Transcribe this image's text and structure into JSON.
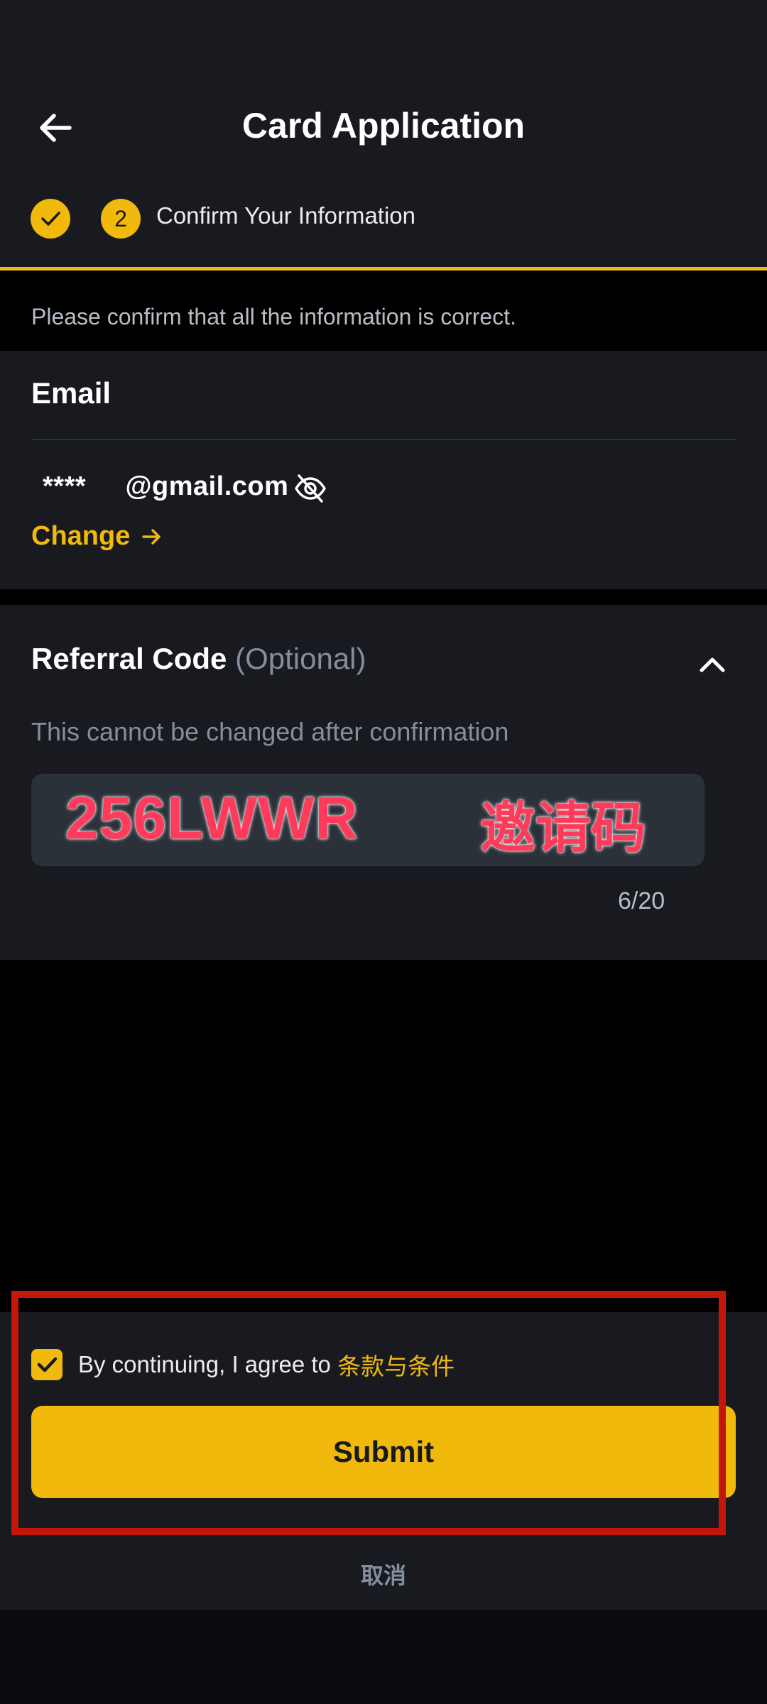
{
  "header": {
    "title": "Card Application",
    "step2_number": "2",
    "step_label": "Confirm Your Information"
  },
  "notice": "Please confirm that all the information is correct.",
  "email_section": {
    "title": "Email",
    "value": "****     @gmail.com",
    "change_label": "Change"
  },
  "referral_section": {
    "title": "Referral Code",
    "optional": "(Optional)",
    "hint": "This cannot be changed after confirmation",
    "code": "256LWWR",
    "overlay_text": "邀请码",
    "counter": "6/20"
  },
  "footer": {
    "agree_prefix": "By continuing, I agree to ",
    "agree_link": "条款与条件",
    "submit_label": "Submit",
    "cancel_label": "取消"
  },
  "colors": {
    "accent": "#f0b90b",
    "background": "#181a20",
    "highlight": "#c4170c",
    "overlay_text": "#ff3b5c"
  }
}
